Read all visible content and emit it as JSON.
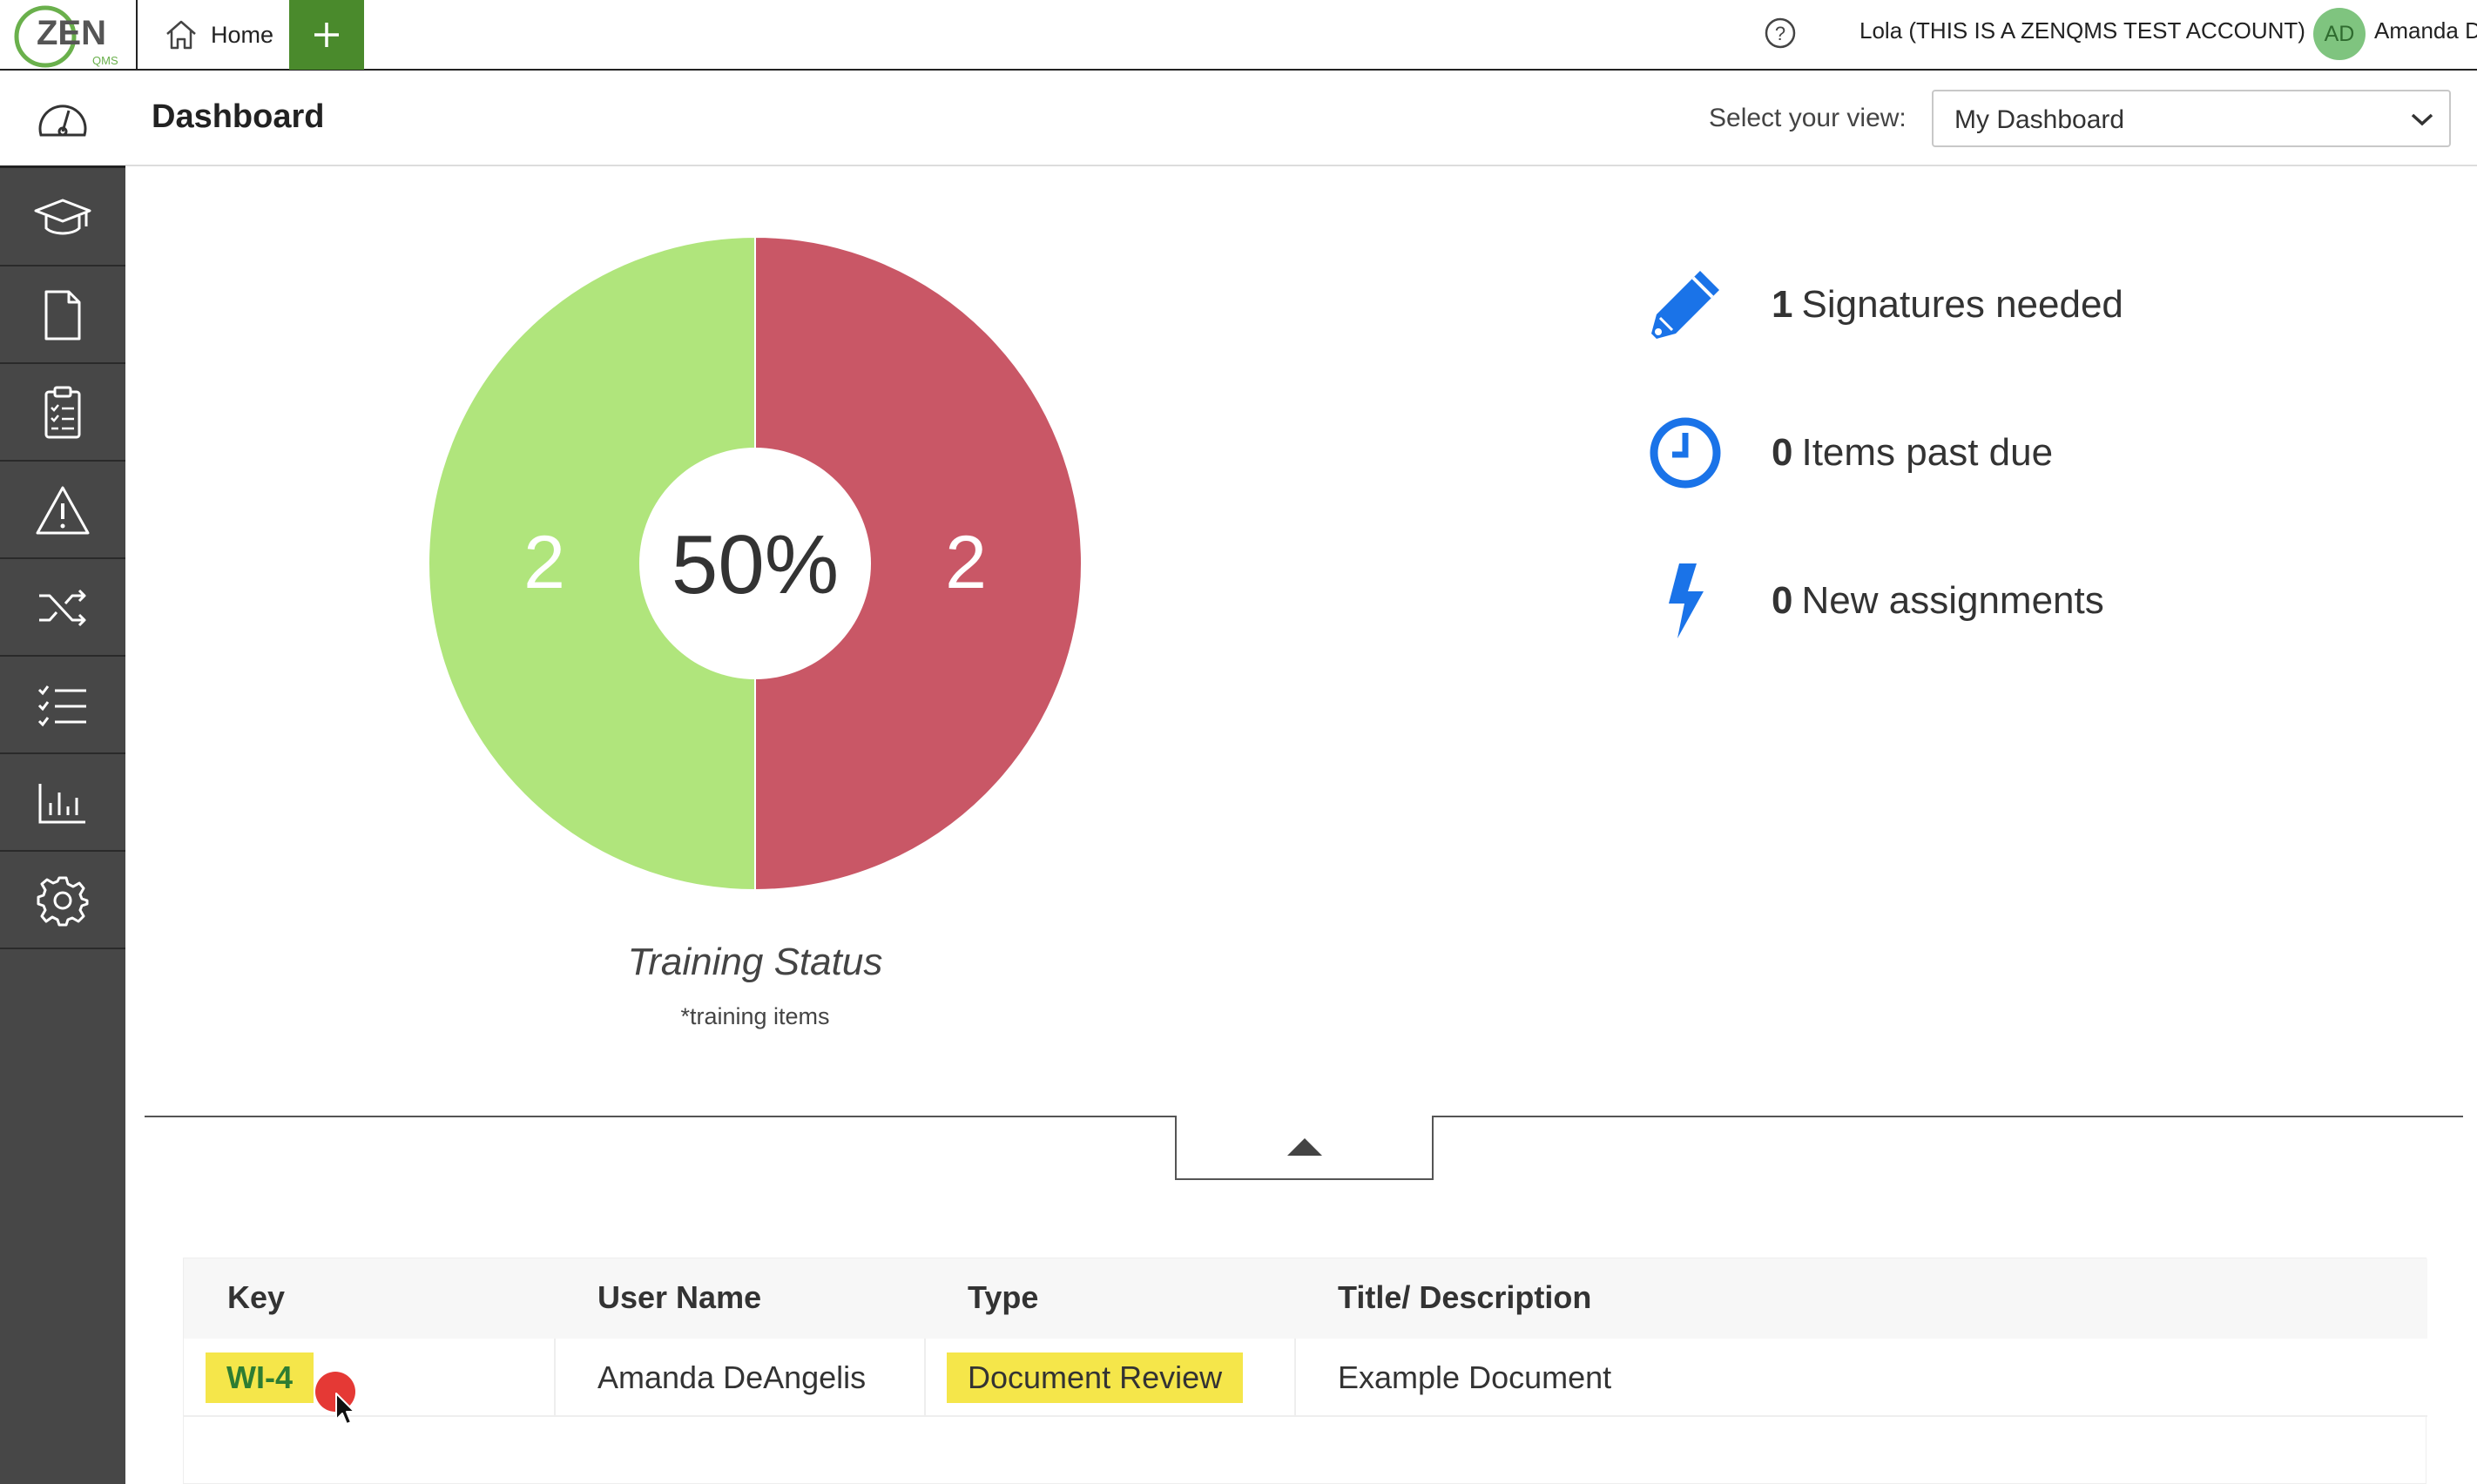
{
  "topbar": {
    "logo_text": "ZEN",
    "logo_sub": "QMS",
    "home_label": "Home",
    "account_label": "Lola (THIS IS A ZENQMS TEST ACCOUNT)",
    "avatar_initials": "AD",
    "user_name": "Amanda D"
  },
  "sidebar": {
    "items": [
      {
        "icon": "dashboard-gauge-icon"
      },
      {
        "icon": "graduation-cap-icon"
      },
      {
        "icon": "document-icon"
      },
      {
        "icon": "clipboard-checklist-icon"
      },
      {
        "icon": "warning-triangle-icon"
      },
      {
        "icon": "shuffle-icon"
      },
      {
        "icon": "checklist-icon"
      },
      {
        "icon": "bar-chart-icon"
      },
      {
        "icon": "gear-icon"
      }
    ]
  },
  "header": {
    "title": "Dashboard",
    "view_label": "Select your view:",
    "view_value": "My Dashboard"
  },
  "chart_data": {
    "type": "pie",
    "title": "Training Status",
    "subtitle": "*training items",
    "center_label": "50%",
    "slices": [
      {
        "value": 2,
        "label": "2",
        "color": "#b0e57c"
      },
      {
        "value": 2,
        "label": "2",
        "color": "#c95766"
      }
    ]
  },
  "stats": [
    {
      "count": "1",
      "label": "Signatures needed",
      "icon": "pencil-icon"
    },
    {
      "count": "0",
      "label": "Items past due",
      "icon": "clock-icon"
    },
    {
      "count": "0",
      "label": "New assignments",
      "icon": "lightning-icon"
    }
  ],
  "table": {
    "headers": [
      "Key",
      "User Name",
      "Type",
      "Title/ Description"
    ],
    "rows": [
      {
        "key": "WI-4",
        "user_name": "Amanda DeAngelis",
        "type": "Document Review",
        "title": "Example Document"
      }
    ]
  },
  "colors": {
    "accent_green": "#4a8a2c",
    "stat_blue": "#1a73e8",
    "highlight": "#f5e64a"
  }
}
